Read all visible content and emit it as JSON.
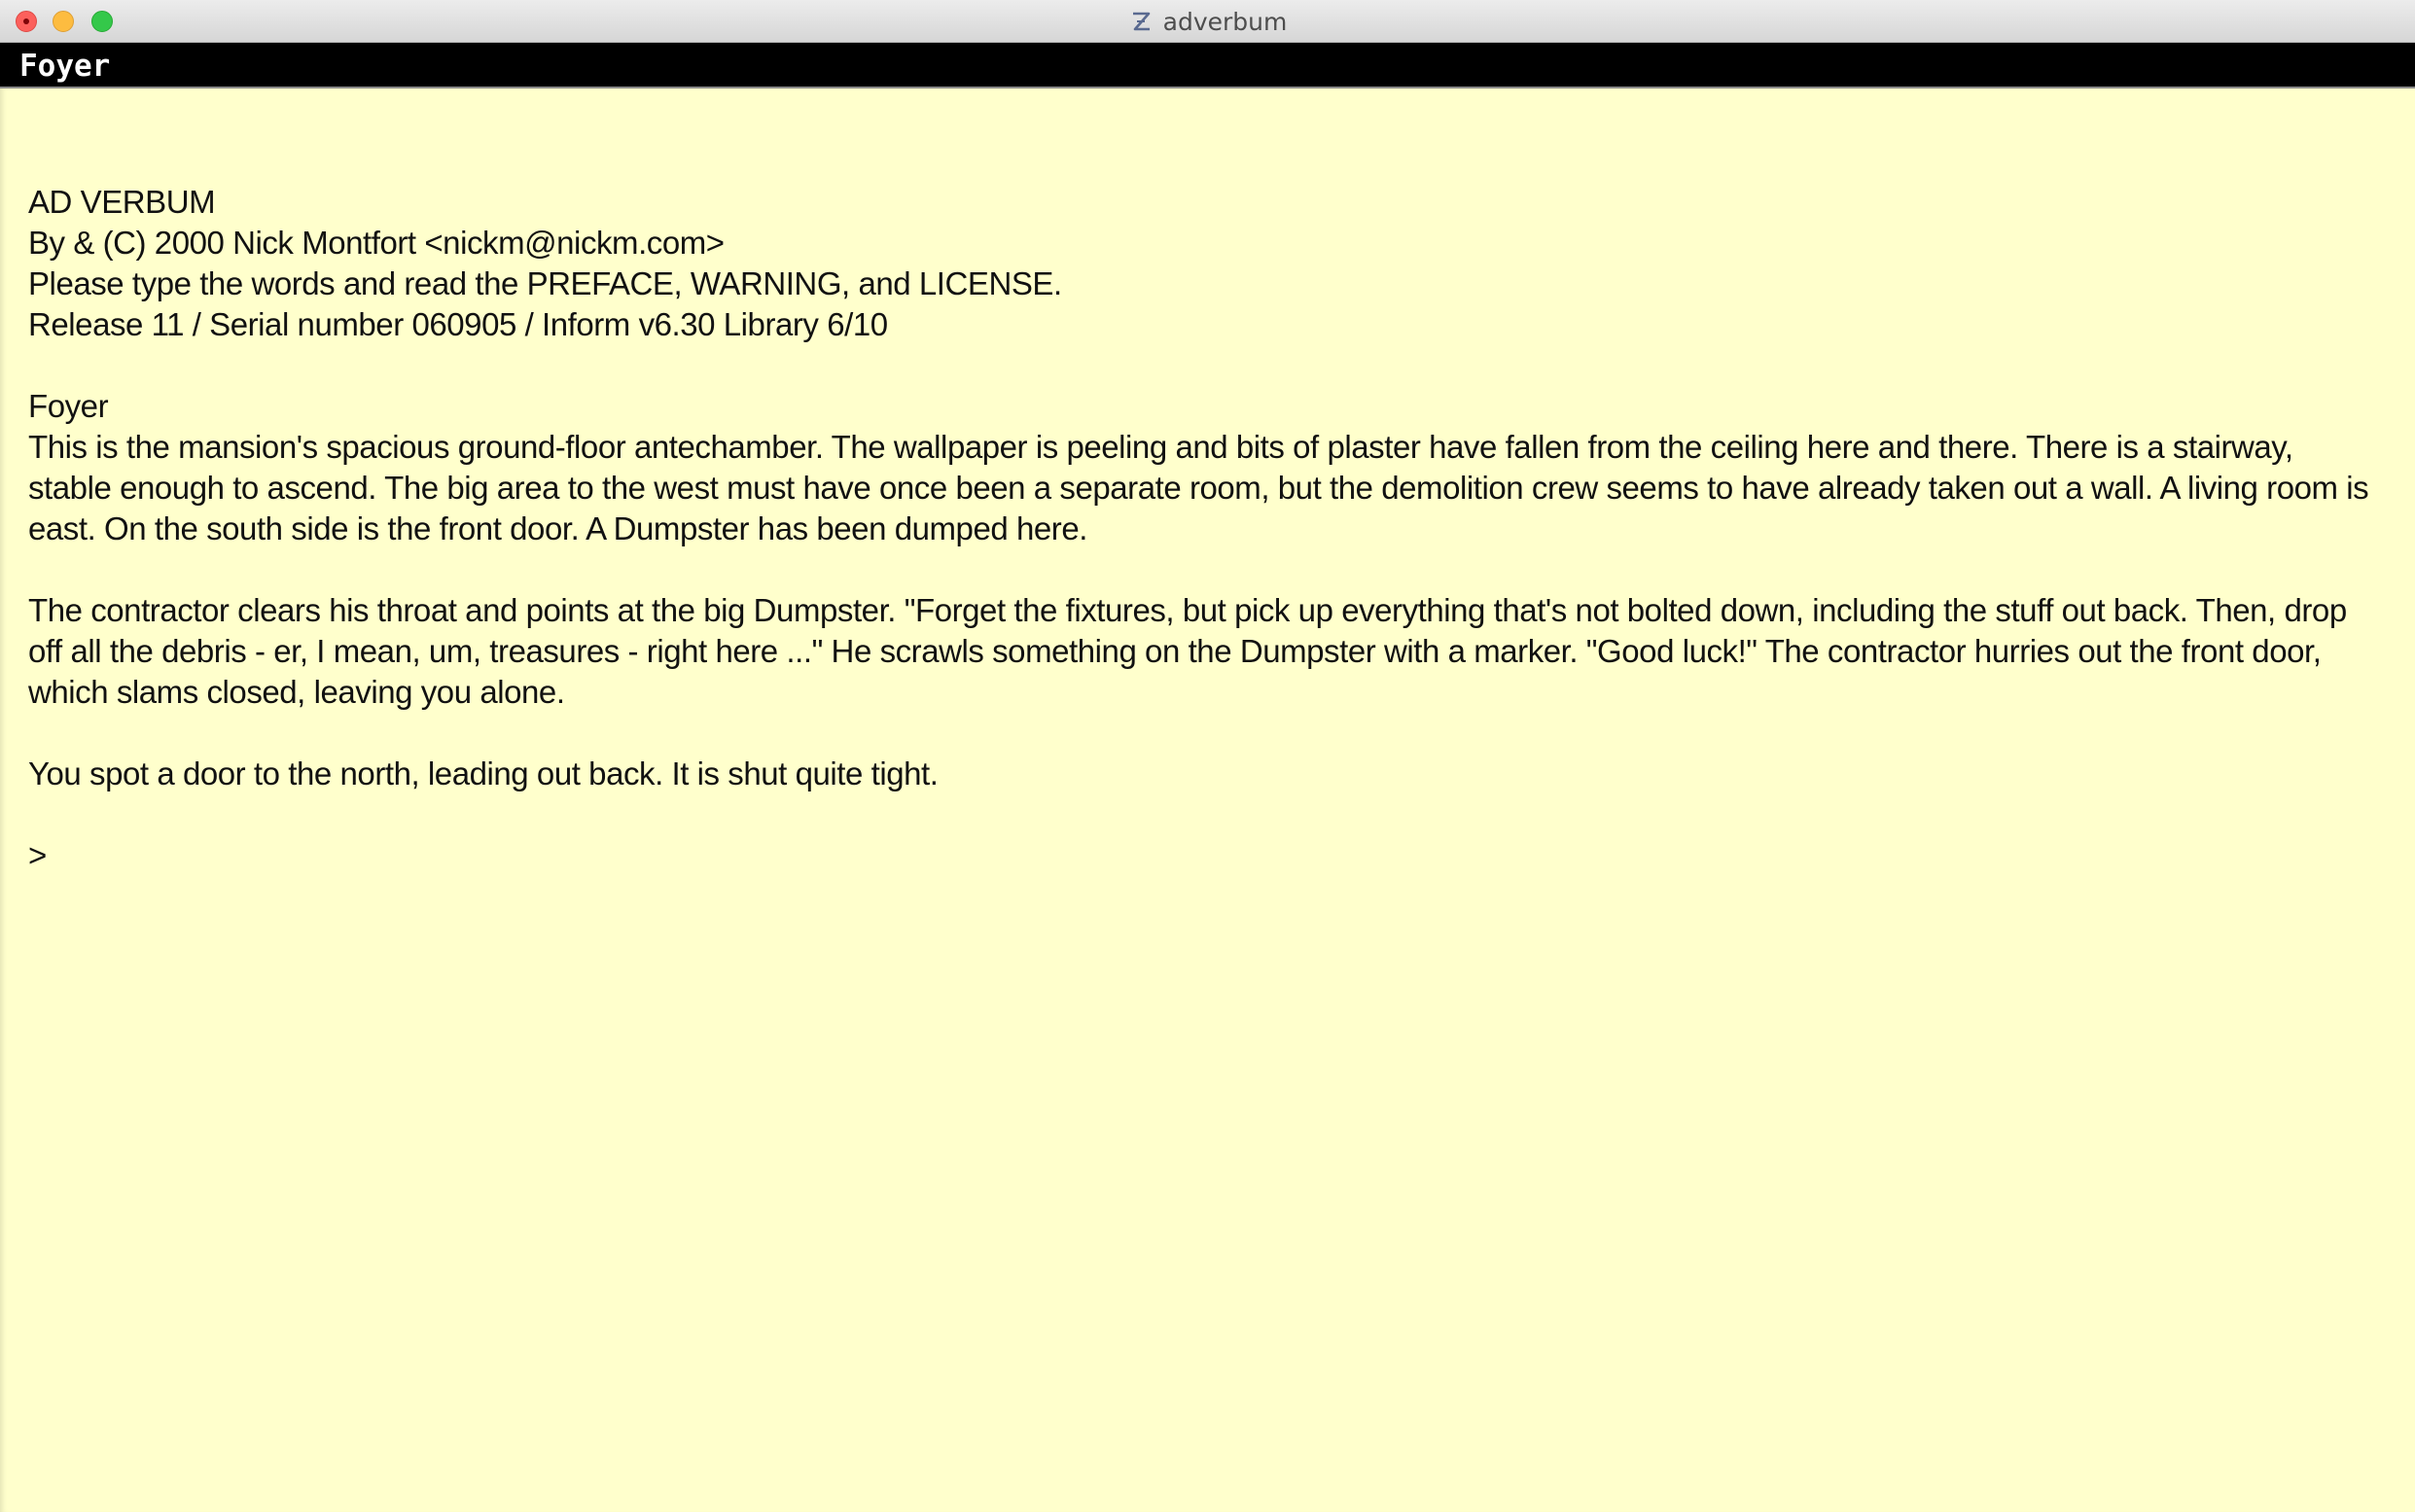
{
  "window": {
    "title": "adverbum",
    "icon": "z-machine-icon"
  },
  "status_bar": {
    "location": "Foyer"
  },
  "story": {
    "banner": [
      "AD VERBUM",
      "By & (C) 2000 Nick Montfort <nickm@nickm.com>",
      "Please type the words and read the PREFACE, WARNING, and LICENSE.",
      "Release 11 / Serial number 060905 / Inform v6.30 Library 6/10"
    ],
    "room_name": "Foyer",
    "room_description": "This is the mansion's spacious ground-floor antechamber. The wallpaper is peeling and bits of plaster have fallen from the ceiling here and there. There is a stairway, stable enough to ascend. The big area to the west must have once been a separate room, but the demolition crew seems to have already taken out a wall. A living room is east. On the south side is the front door. A Dumpster has been dumped here.",
    "contractor_text": "The contractor clears his throat and points at the big Dumpster. \"Forget the fixtures, but pick up everything that's not bolted down, including the stuff out back. Then, drop off all the debris - er, I mean, um, treasures - right here ...\" He scrawls something on the Dumpster with a marker. \"Good luck!\" The contractor hurries out the front door, which slams closed, leaving you alone.",
    "door_text": "You spot a door to the north, leading out back. It is shut quite tight.",
    "prompt": ">",
    "input_value": ""
  },
  "colors": {
    "background": "#ffffcc",
    "text": "#111111",
    "status_background": "#000000",
    "status_text": "#ffffff"
  }
}
